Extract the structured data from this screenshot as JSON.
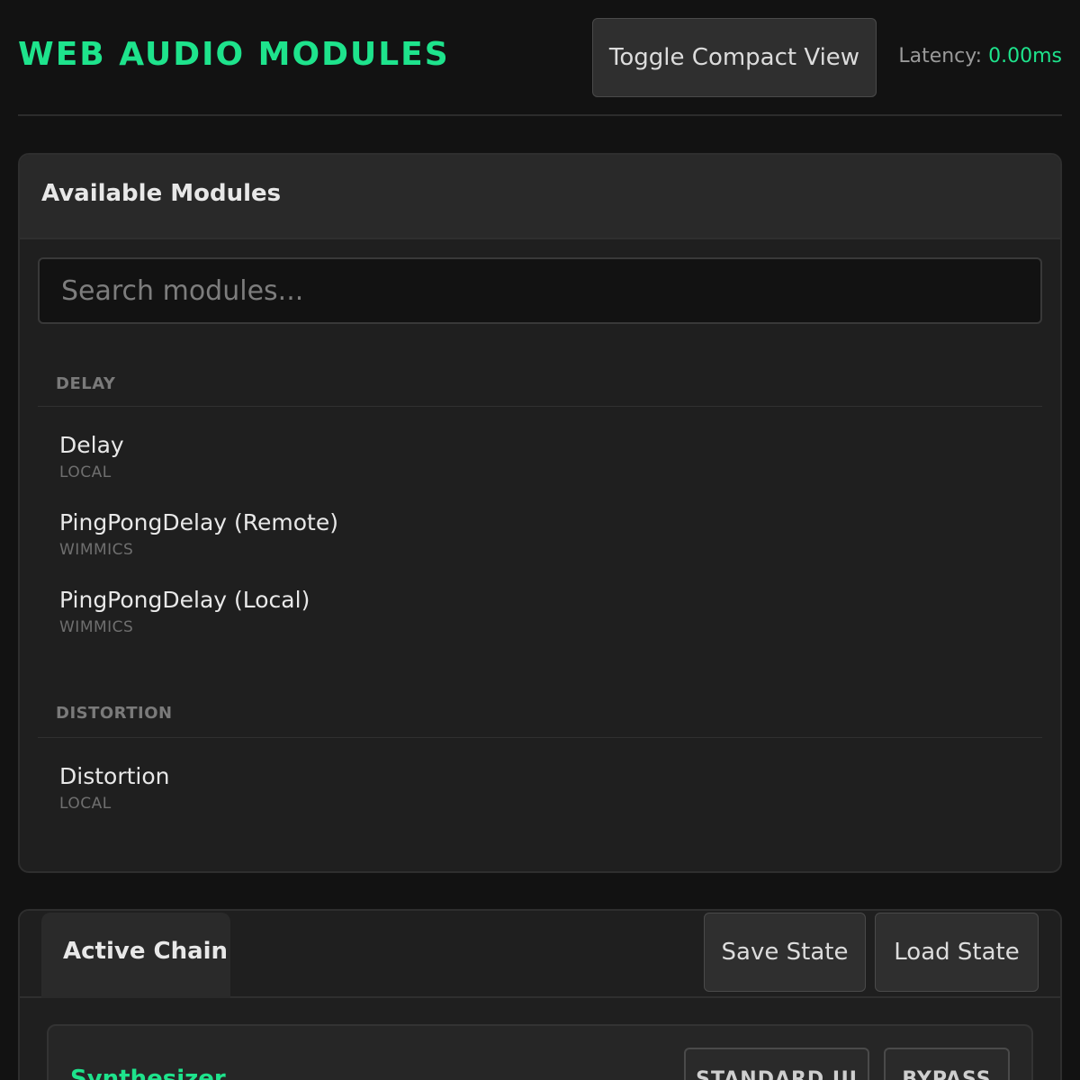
{
  "header": {
    "title": "WEB AUDIO MODULES",
    "toggle_label": "Toggle Compact View",
    "latency_label": "Latency:",
    "latency_value": "0.00ms"
  },
  "modules_panel": {
    "title": "Available Modules",
    "search": {
      "placeholder": "Search modules...",
      "value": ""
    },
    "categories": [
      {
        "name": "DELAY",
        "items": [
          {
            "name": "Delay",
            "source": "LOCAL"
          },
          {
            "name": "PingPongDelay (Remote)",
            "source": "WIMMICS"
          },
          {
            "name": "PingPongDelay (Local)",
            "source": "WIMMICS"
          }
        ]
      },
      {
        "name": "DISTORTION",
        "items": [
          {
            "name": "Distortion",
            "source": "LOCAL"
          }
        ]
      }
    ]
  },
  "chain_panel": {
    "tab_label": "Active Chain",
    "save_label": "Save State",
    "load_label": "Load State",
    "modules": [
      {
        "name": "Synthesizer",
        "view_label": "STANDARD UI",
        "bypass_label": "BYPASS"
      }
    ]
  },
  "colors": {
    "accent": "#1ee38c",
    "background": "#121212",
    "panel": "#1f1f1f"
  }
}
